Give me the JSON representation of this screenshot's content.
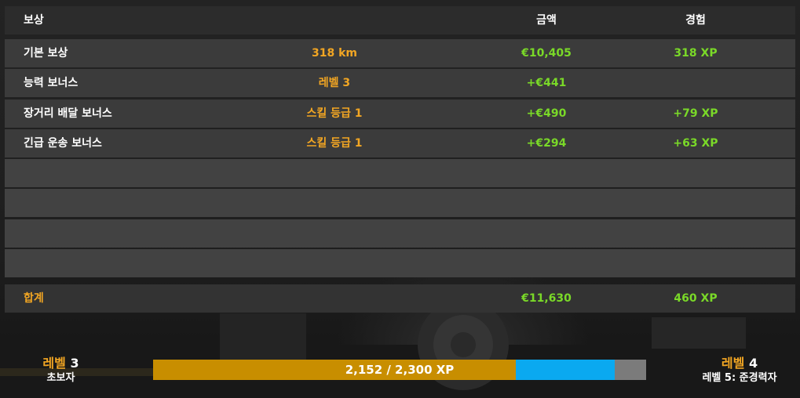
{
  "table": {
    "header": {
      "label": "보상",
      "amount": "금액",
      "xp": "경험"
    },
    "rows": [
      {
        "label": "기본 보상",
        "detail": "318 km",
        "amount": "€10,405",
        "xp": "318 XP"
      },
      {
        "label": "능력 보너스",
        "detail": "레벨 3",
        "amount": "+€441",
        "xp": ""
      },
      {
        "label": "장거리 배달 보너스",
        "detail": "스킬 등급 1",
        "amount": "+€490",
        "xp": "+79 XP"
      },
      {
        "label": "긴급 운송 보너스",
        "detail": "스킬 등급 1",
        "amount": "+€294",
        "xp": "+63 XP"
      }
    ],
    "total": {
      "label": "합계",
      "amount": "€11,630",
      "xp": "460 XP"
    }
  },
  "progress": {
    "current_level": {
      "word": "레벨",
      "number": "3",
      "title": "초보자"
    },
    "next_level": {
      "word": "레벨",
      "number": "4",
      "title": "레벨 5: 준경력자"
    },
    "text": "2,152 / 2,300 XP",
    "current_xp": 2152,
    "max_xp": 2300,
    "previous_xp": 1692
  },
  "colors": {
    "accent_orange": "#f2a623",
    "money_green": "#7ad928",
    "bar_previous": "#c88e00",
    "bar_gain": "#0aa9f0",
    "bar_remaining": "#7b7b7b"
  }
}
